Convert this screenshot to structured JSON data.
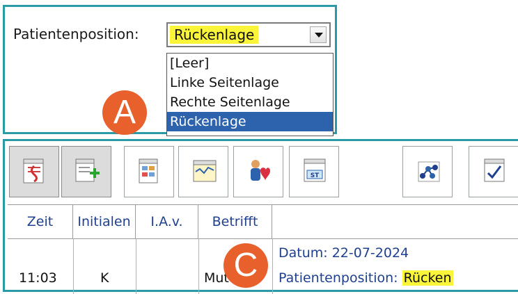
{
  "panel_a": {
    "label": "Patientenposition:",
    "selected_value": "Rückenlage",
    "options": [
      "[Leer]",
      "Linke Seitenlage",
      "Rechte Seitenlage",
      "Rückenlage"
    ],
    "badge": "A"
  },
  "toolbar": {
    "buttons": [
      {
        "icon": "caduceus-notepad-icon",
        "state": "pressed"
      },
      {
        "icon": "add-notepad-icon",
        "state": "pressed"
      },
      {
        "icon": "calendar-notepad-icon",
        "state": "normal"
      },
      {
        "icon": "chart-notepad-icon",
        "state": "normal"
      },
      {
        "icon": "patient-heart-icon",
        "state": "normal"
      },
      {
        "icon": "st-notepad-icon",
        "state": "normal"
      },
      {
        "icon": "molecule-icon",
        "state": "normal"
      },
      {
        "icon": "checklist-icon",
        "state": "normal"
      }
    ]
  },
  "table": {
    "headers": [
      "Zeit",
      "Initialen",
      "I.A.v.",
      "Betrifft"
    ],
    "date_line": "Datum: 22-07-2024",
    "row": {
      "zeit": "11:03",
      "initialen": "K",
      "betrifft": "Mut",
      "position_label": "Patientenposition:",
      "position_value": "Rücken"
    }
  },
  "badge_c": "C",
  "colors": {
    "frame": "#2a9aa6",
    "highlight": "#fbf53a",
    "selection": "#2d63ad",
    "badge": "#e8602b"
  }
}
